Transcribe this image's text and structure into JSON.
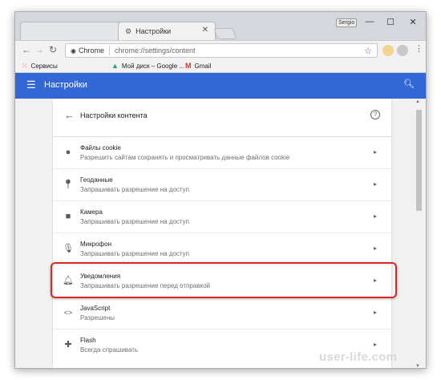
{
  "browser": {
    "tabs": [
      {
        "label": ""
      },
      {
        "label": "Настройки"
      }
    ],
    "profile_label": "Sergio",
    "address": {
      "chip_label": "Chrome",
      "url": "chrome://settings/content"
    },
    "bookmarks": [
      {
        "label": "Сервисы"
      },
      {
        "label": "Мой диск – Google ..."
      },
      {
        "label": "Gmail"
      }
    ]
  },
  "appbar": {
    "title": "Настройки"
  },
  "settings": {
    "header_title": "Настройки контента",
    "rows": [
      {
        "title": "Файлы cookie",
        "subtitle": "Разрешить сайтам сохранять и просматривать данные файлов cookie",
        "icon": "cookie-icon"
      },
      {
        "title": "Геоданные",
        "subtitle": "Запрашивать разрешение на доступ",
        "icon": "location-icon"
      },
      {
        "title": "Камера",
        "subtitle": "Запрашивать разрешение на доступ",
        "icon": "camera-icon"
      },
      {
        "title": "Микрофон",
        "subtitle": "Запрашивать разрешение на доступ",
        "icon": "microphone-icon"
      },
      {
        "title": "Уведомления",
        "subtitle": "Запрашивать разрешение перед отправкой",
        "icon": "bell-icon"
      },
      {
        "title": "JavaScript",
        "subtitle": "Разрешены",
        "icon": "code-icon"
      },
      {
        "title": "Flash",
        "subtitle": "Всегда спрашивать",
        "icon": "puzzle-icon"
      }
    ]
  },
  "watermark": "user-life.com",
  "colors": {
    "appbar": "#3367d6",
    "highlight": "#d9281f"
  }
}
